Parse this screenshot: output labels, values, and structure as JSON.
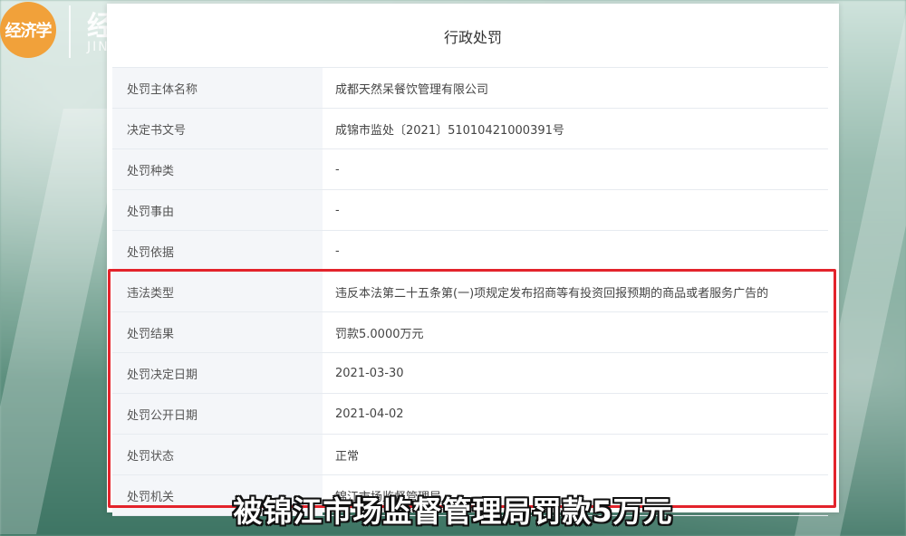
{
  "brand": {
    "logo_text": "经济学",
    "name": "经济学",
    "sub": "JIN"
  },
  "panel": {
    "title": "行政处罚",
    "rows": [
      {
        "label": "处罚主体名称",
        "value": "成都天然呆餐饮管理有限公司"
      },
      {
        "label": "决定书文号",
        "value": "成锦市监处〔2021〕51010421000391号"
      },
      {
        "label": "处罚种类",
        "value": "-"
      },
      {
        "label": "处罚事由",
        "value": "-"
      },
      {
        "label": "处罚依据",
        "value": "-"
      },
      {
        "label": "违法类型",
        "value": "违反本法第二十五条第(一)项规定发布招商等有投资回报预期的商品或者服务广告的"
      },
      {
        "label": "处罚结果",
        "value": "罚款5.0000万元"
      },
      {
        "label": "处罚决定日期",
        "value": "2021-03-30"
      },
      {
        "label": "处罚公开日期",
        "value": "2021-04-02"
      },
      {
        "label": "处罚状态",
        "value": "正常"
      },
      {
        "label": "处罚机关",
        "value": "锦江市场监督管理局"
      }
    ]
  },
  "caption": "被锦江市场监督管理局罚款5万元",
  "colors": {
    "highlight": "#e3232b",
    "logo": "#f1a13a"
  }
}
